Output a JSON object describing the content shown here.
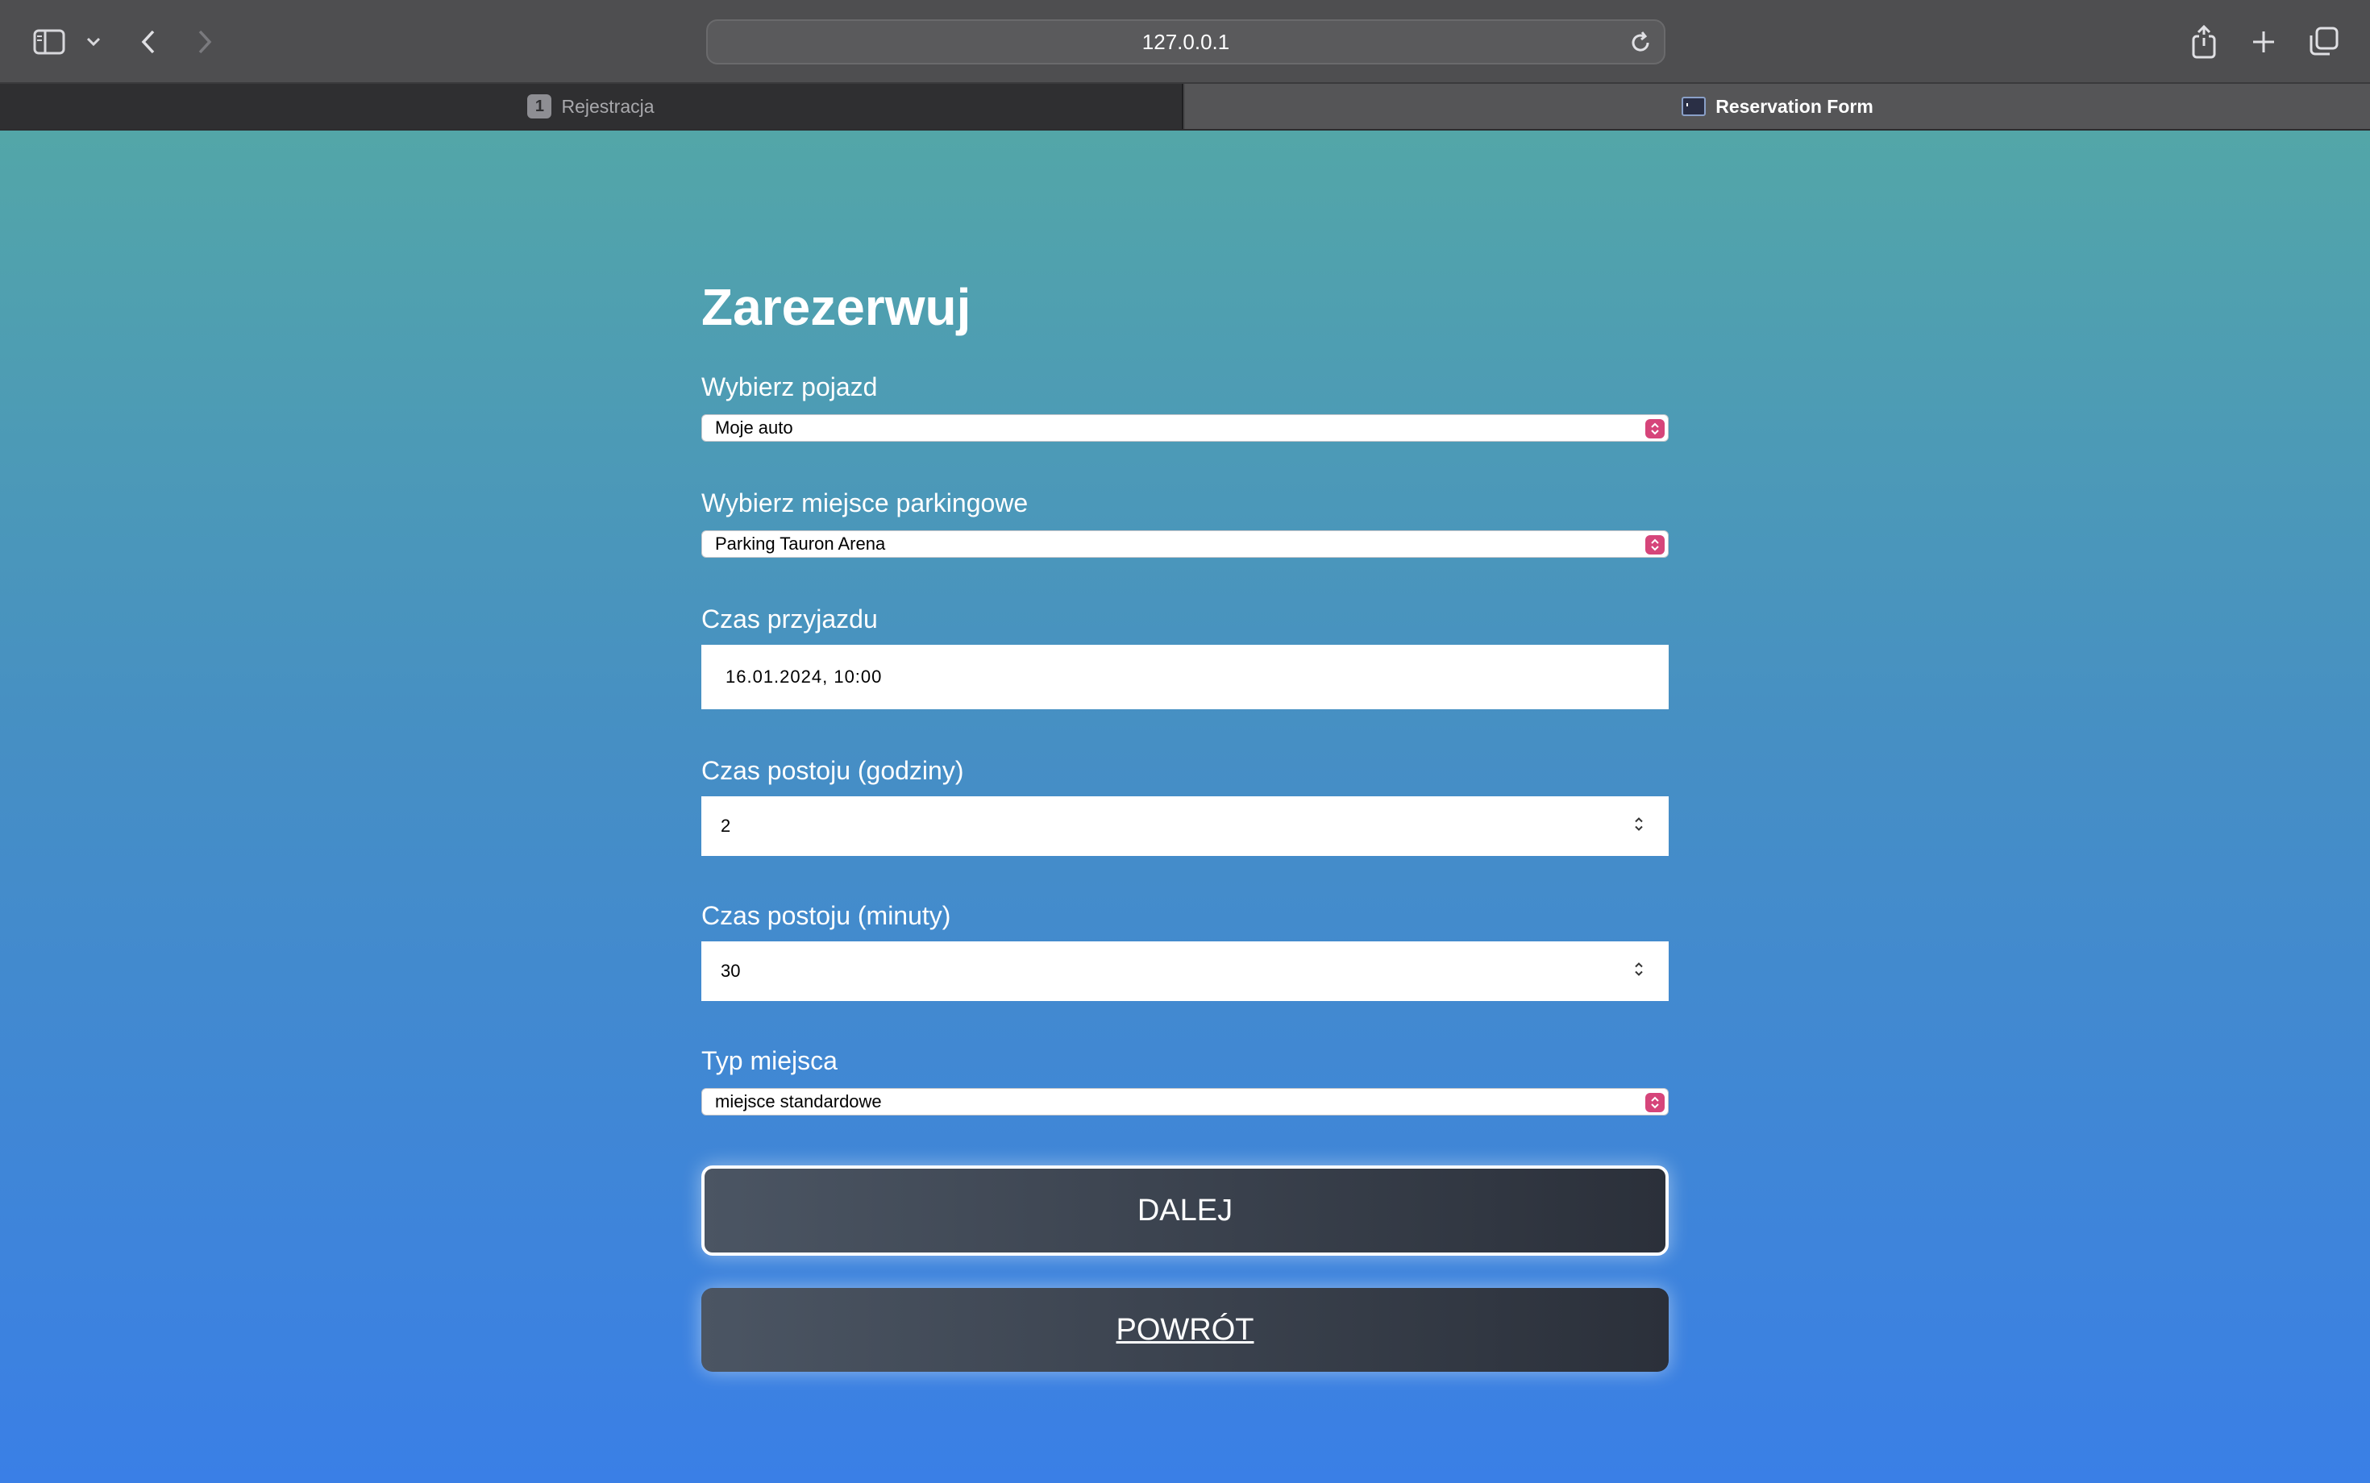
{
  "browser": {
    "url": "127.0.0.1",
    "tabs": [
      {
        "label": "Rejestracja",
        "badge": "1",
        "active": false
      },
      {
        "label": "Reservation Form",
        "active": true
      }
    ]
  },
  "form": {
    "title": "Zarezerwuj",
    "vehicle": {
      "label": "Wybierz pojazd",
      "value": "Moje auto"
    },
    "parking": {
      "label": "Wybierz miejsce parkingowe",
      "value": "Parking Tauron Arena"
    },
    "arrival": {
      "label": "Czas przyjazdu",
      "value": "16.01.2024, 10:00"
    },
    "hours": {
      "label": "Czas postoju (godziny)",
      "value": "2"
    },
    "minutes": {
      "label": "Czas postoju (minuty)",
      "value": "30"
    },
    "spot_type": {
      "label": "Typ miejsca",
      "value": "miejsce standardowe"
    },
    "next_button": "DALEJ",
    "back_button": "POWRÓT"
  },
  "colors": {
    "gradient_top": "#53a6a8",
    "gradient_bottom": "#3a7fe6",
    "button_dark": "#2b303a",
    "select_accent": "#d6457a"
  }
}
